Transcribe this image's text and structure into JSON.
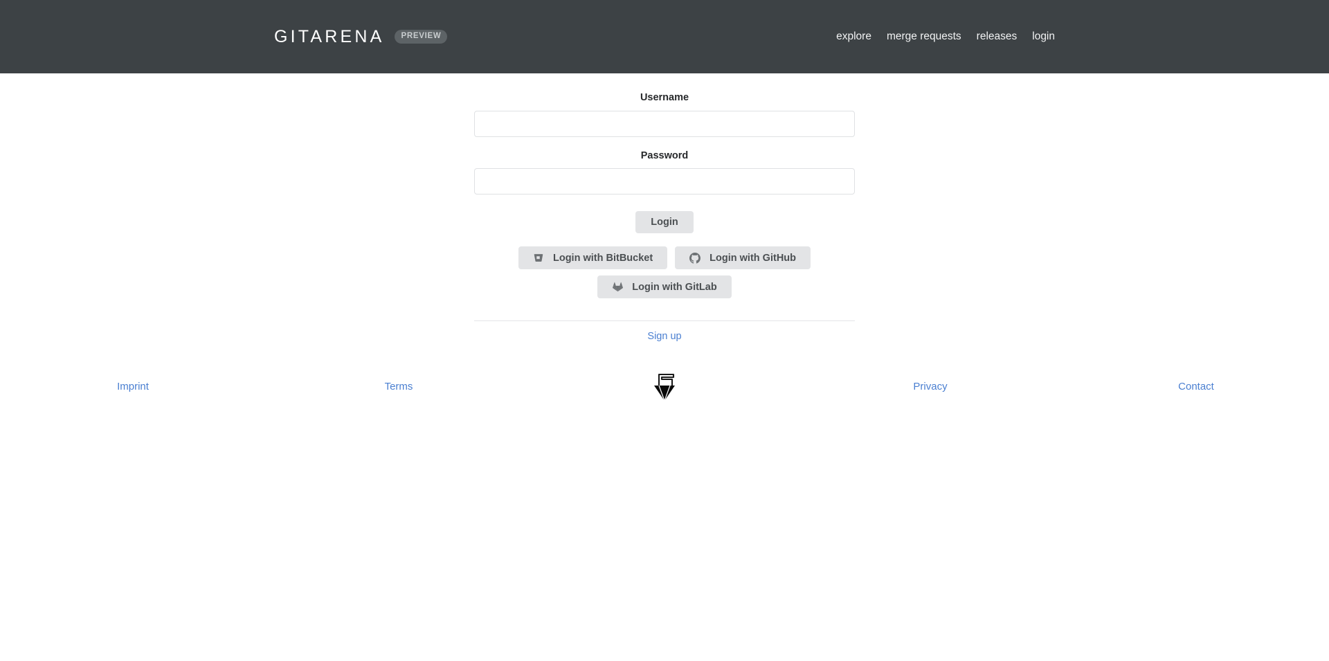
{
  "header": {
    "brand_name": "GITARENA",
    "badge_label": "PREVIEW",
    "background_color": "#3d4245",
    "nav": [
      {
        "label": "explore",
        "name": "nav-link-explore"
      },
      {
        "label": "merge requests",
        "name": "nav-link-merge-requests"
      },
      {
        "label": "releases",
        "name": "nav-link-releases"
      },
      {
        "label": "login",
        "name": "nav-link-login"
      }
    ]
  },
  "form": {
    "username": {
      "label": "Username",
      "value": "",
      "placeholder": ""
    },
    "password": {
      "label": "Password",
      "value": "",
      "placeholder": ""
    },
    "login_button_label": "Login",
    "oauth": [
      {
        "label": "Login with BitBucket",
        "icon": "bitbucket-icon"
      },
      {
        "label": "Login with GitHub",
        "icon": "github-icon"
      },
      {
        "label": "Login with GitLab",
        "icon": "gitlab-icon"
      }
    ],
    "signup_label": "Sign up",
    "link_color": "#4a7fd1",
    "button_color": "#e3e4e6"
  },
  "footer": {
    "links": [
      {
        "label": "Imprint"
      },
      {
        "label": "Terms"
      },
      {
        "label": "Privacy"
      },
      {
        "label": "Contact"
      }
    ],
    "logo_icon": "gitarena-diamond-logo-icon"
  }
}
